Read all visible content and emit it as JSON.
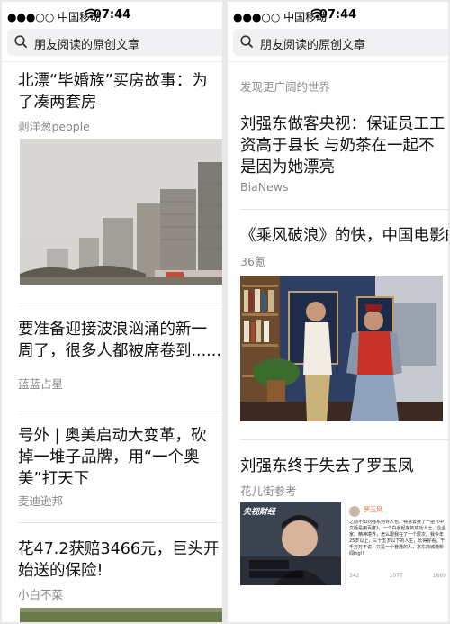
{
  "status_bar": {
    "carrier": "●●●○○ 中国移动",
    "time": "07:44"
  },
  "search": {
    "query": "朋友阅读的原创文章"
  },
  "left_feed": {
    "articles": [
      {
        "title": "北漂“毕婚族”买房故事：为了凑两套房",
        "source": "剥洋葱people"
      },
      {
        "title": "要准备迎接波浪汹涌的新一周了，很多人都被席卷到......",
        "source": "蓝蓝占星"
      },
      {
        "title": "号外 | 奥美启动大变革，砍掉一堆子品牌，用“一个奥美”打天下",
        "source": "麦迪逊邦"
      },
      {
        "title": "花47.2获赔3466元，巨头开始送的保险!",
        "source": "小白不菜"
      }
    ]
  },
  "right_feed": {
    "hint": "发现更广阔的世界",
    "articles": [
      {
        "title": "刘强东做客央视：保证员工工资高于县长 与奶茶在一起不是因为她漂亮",
        "source": "BiaNews"
      },
      {
        "title": "《乘风破浪》的快，中国电影的慢",
        "source": "36氪"
      },
      {
        "title": "刘强东终于失去了罗玉凤",
        "source": "花儿街参考"
      }
    ],
    "weibo_card": {
      "name": "罗玉凤",
      "text": "之前不知刘强东何许人也。特意去搜了一把《中文版是用百度》，一个白手起家的成功人士。企业家。精神境界，怎么跟我在了一个层次。我今年25岁以上，三十五岁以下的人生，长得好看，千千万万不说，只是一个普通的人，京东商城洗新闻ing!!",
      "stats": [
        "342",
        "1077",
        "1669"
      ]
    },
    "video_overlay": "央视财经"
  }
}
